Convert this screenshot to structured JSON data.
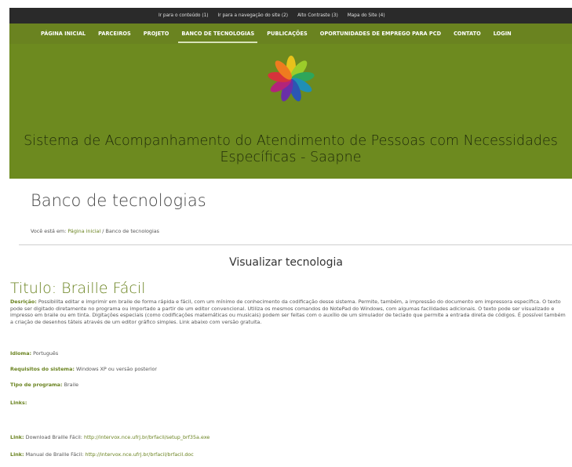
{
  "accessibility": {
    "links": [
      "Ir para o conteúdo (1)",
      "Ir para a navegação do site (2)",
      "Alto Contraste (3)",
      "Mapa do Site (4)"
    ]
  },
  "nav": {
    "items": [
      "PÁGINA INICIAL",
      "PARCEIROS",
      "PROJETO",
      "BANCO DE TECNOLOGIAS",
      "PUBLICAÇÕES",
      "OPORTUNIDADES DE EMPREGO PARA PCD",
      "CONTATO",
      "LOGIN"
    ],
    "active": "BANCO DE TECNOLOGIAS"
  },
  "banner": {
    "title_line1": "Sistema de Acompanhamento do Atendimento de Pessoas com Necessidades",
    "title_line2": "Específicas - Saapne"
  },
  "page": {
    "title": "Banco de tecnologias",
    "breadcrumb_prefix": "Você está em:",
    "breadcrumb_home": "Página inicial",
    "breadcrumb_sep": "/",
    "breadcrumb_current": "Banco de tecnologias"
  },
  "content": {
    "section_title": "Visualizar tecnologia",
    "tech_title": "Titulo: Braille Fácil",
    "desc_label": "Desrição:",
    "desc_text": "Possibilita editar e imprimir em braile de forma rápida e fácil, com um mínimo de conhecimento da codificação desse sistema. Permite, também, a impressão do documento em impressora específica. O texto pode ser digitado diretamente no programa ou importado a partir de um editor convencional. Utiliza os mesmos comandos do NotePad do Windows, com algumas facilidades adicionais. O texto pode ser visualizado e impresso em braile ou em tinta. Digitações especiais (como codificações matemáticas ou musicais) podem ser feitas com o auxílio de um simulador de teclado que permite a entrada direta de códigos. É possível também a criação de desenhos táteis através de um editor gráfico simples. Link abaixo com versão gratuita.",
    "idioma_label": "Idioma:",
    "idioma_value": "Português",
    "req_label": "Requisitos do sistema:",
    "req_value": "Windows XP ou versão posterior",
    "tipo_label": "Tipo de programa:",
    "tipo_value": "Braile",
    "links_label": "Links:",
    "link1_label": "Link:",
    "link1_text": "Download Braille Fácil:",
    "link1_url": "http://intervox.nce.ufrj.br/brfacil/setup_brf35a.exe",
    "link2_label": "Link:",
    "link2_text": "Manual de Braille Fácil:",
    "link2_url": "http://intervox.nce.ufrj.br/brfacil/brfacil.doc"
  },
  "colors": {
    "green_nav": "#6a8320",
    "green_banner": "#6d8a1f",
    "dark_bar": "#2a2a2a",
    "link_green": "#6a8320"
  },
  "icons": {
    "logo": "colorful-pinwheel-logo"
  }
}
